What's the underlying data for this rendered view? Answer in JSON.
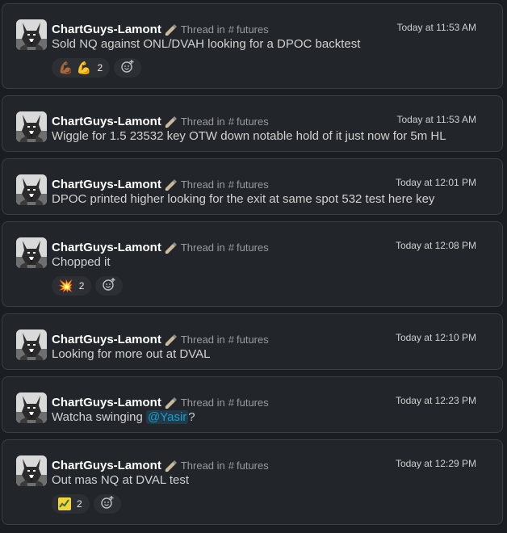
{
  "messages": [
    {
      "author": "ChartGuys-Lamont",
      "thread_prefix": "Thread in",
      "channel": "futures",
      "time": "Today at 11:53 AM",
      "text": "Sold NQ against ONL/DVAH looking for a DPOC backtest",
      "reactions": [
        {
          "emoji": "💪🏾 💪",
          "count": "2"
        }
      ]
    },
    {
      "author": "ChartGuys-Lamont",
      "thread_prefix": "Thread in",
      "channel": "futures",
      "time": "Today at 11:53 AM",
      "text": "Wiggle for 1.5 23532 key OTW down notable hold of it just now for 5m HL"
    },
    {
      "author": "ChartGuys-Lamont",
      "thread_prefix": "Thread in",
      "channel": "futures",
      "time": "Today at 12:01 PM",
      "text": "DPOC printed higher looking for the exit at same spot 532 test here key"
    },
    {
      "author": "ChartGuys-Lamont",
      "thread_prefix": "Thread in",
      "channel": "futures",
      "time": "Today at 12:08 PM",
      "text": "Chopped it",
      "reactions": [
        {
          "emoji": "💥",
          "count": "2"
        }
      ]
    },
    {
      "author": "ChartGuys-Lamont",
      "thread_prefix": "Thread in",
      "channel": "futures",
      "time": "Today at 12:10 PM",
      "text": "Looking for more out at DVAL"
    },
    {
      "author": "ChartGuys-Lamont",
      "thread_prefix": "Thread in",
      "channel": "futures",
      "time": "Today at 12:23 PM",
      "text_before": "Watcha swinging ",
      "mention": "@Yasir",
      "text_after": "?"
    },
    {
      "author": "ChartGuys-Lamont",
      "thread_prefix": "Thread in",
      "channel": "futures",
      "time": "Today at 12:29 PM",
      "text": "Out mas NQ at DVAL test",
      "reactions": [
        {
          "emoji": "custom-chart-emoji",
          "count": "2"
        }
      ]
    }
  ],
  "icons": {
    "hash": "#",
    "status": "pencil-status-icon",
    "add_reaction": "add-reaction-icon"
  },
  "colors": {
    "background": "#1a1d21",
    "card": "#222529",
    "mention": "#1d9bd1"
  }
}
